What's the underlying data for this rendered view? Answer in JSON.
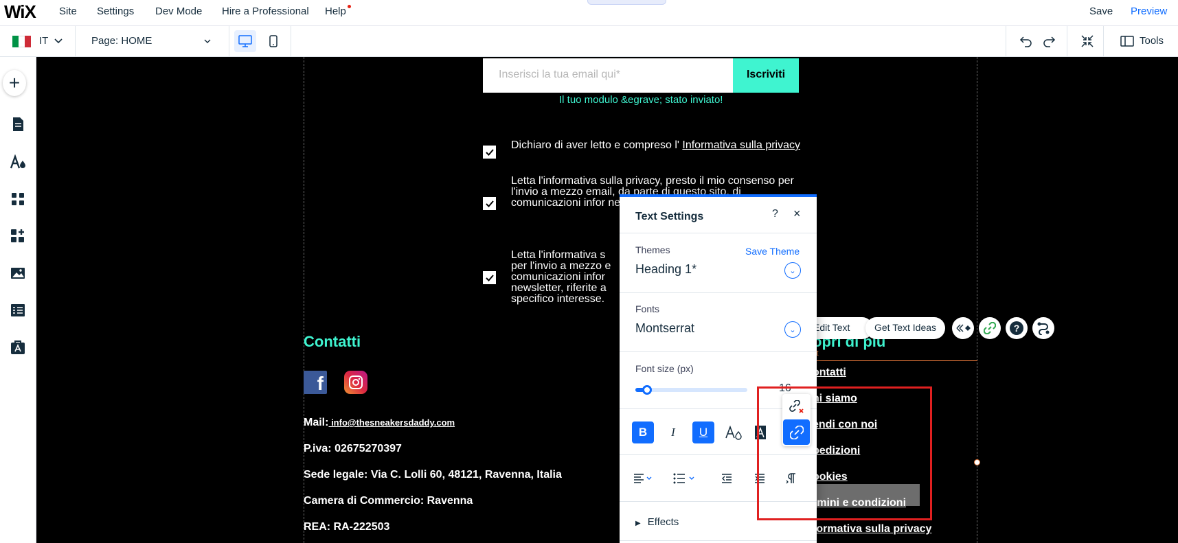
{
  "topbar": {
    "logo": "WiX",
    "menu": [
      "Site",
      "Settings",
      "Dev Mode",
      "Hire a Professional",
      "Help"
    ],
    "save": "Save",
    "preview": "Preview"
  },
  "secondbar": {
    "language": "IT",
    "page": "Page: HOME",
    "tools": "Tools"
  },
  "canvas": {
    "email_placeholder": "Inserisci la tua email qui*",
    "subscribe": "Iscriviti",
    "success": "Il tuo modulo &egrave; stato inviato!",
    "consent1_text": "Dichiaro di aver letto e compreso l' ",
    "consent1_link": "Informativa sulla privacy",
    "consent2": "Letta l'informativa sulla privacy, presto il mio consenso per l'invio a mezzo email, da parte di questo sito, di comunicazioni infor newsletter, riferite a terzi e per lo svolgim",
    "consent3": "Letta l'informativa s per l'invio a mezzo e comunicazioni infor newsletter, riferite a specifico interesse.",
    "contatti_title": "Contatti",
    "mail_label": "Mail:",
    "mail_link": " info@thesneakersdaddy.com",
    "piva": "P.iva: 02675270397",
    "sede": "Sede legale: Via C. Lolli 60, 48121, Ravenna, Italia",
    "camera": "Camera di Commercio: Ravenna",
    "rea": "REA: RA-222503",
    "scopri_title": "opri di più",
    "text_tag": "xt",
    "scopri_links": [
      "ontatti",
      "hi siamo",
      "endi con noi",
      "pedizioni",
      "ookies",
      "rmini e condizioni",
      "formativa sulla privacy"
    ]
  },
  "floating_toolbar": {
    "edit_text": "Edit Text",
    "get_text_ideas": "Get Text Ideas"
  },
  "panel": {
    "title": "Text Settings",
    "help": "?",
    "close": "×",
    "themes_label": "Themes",
    "save_theme": "Save Theme",
    "theme_value": "Heading 1*",
    "fonts_label": "Fonts",
    "font_value": "Montserrat",
    "font_size_label": "Font size (px)",
    "font_size": "16",
    "font_size_fraction": 0.08,
    "effects": "Effects",
    "bold": "B",
    "italic": "I",
    "underline": "U"
  },
  "colors": {
    "accent_blue": "#116dff",
    "teal": "#3ff4d0",
    "canvas_bg": "#000000",
    "selection_orange": "#e8793a",
    "annotation_red": "#e02020"
  },
  "icons": [
    "plus-icon",
    "pages-icon",
    "theme-icon",
    "apps-icon",
    "add-apps-icon",
    "media-icon",
    "table-icon",
    "portfolio-icon",
    "desktop-icon",
    "mobile-icon",
    "undo-icon",
    "redo-icon",
    "zoom-out-icon",
    "tools-icon",
    "unlink-icon",
    "link-icon"
  ]
}
